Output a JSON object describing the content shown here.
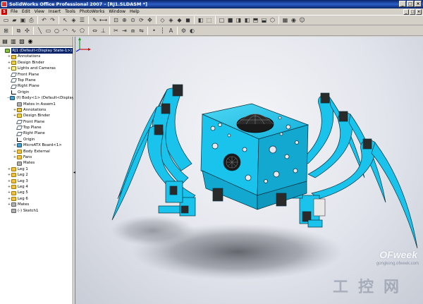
{
  "window": {
    "title": "SolidWorks Office Professional 2007 - [RJ1.SLDASM *]",
    "buttons": [
      "_",
      "□",
      "×"
    ]
  },
  "menu": {
    "items": [
      "File",
      "Edit",
      "View",
      "Insert",
      "Tools",
      "PhotoWorks",
      "Window",
      "Help"
    ],
    "buttons": [
      "_",
      "□",
      "×"
    ]
  },
  "toolbar1": {
    "icons": [
      "new-icon",
      "open-icon",
      "save-icon",
      "print-icon",
      "sep",
      "undo-icon",
      "redo-icon",
      "sep",
      "select-icon",
      "rebuild-icon",
      "options-icon",
      "sep",
      "sketch-icon",
      "smart-dimension-icon",
      "sep",
      "zoom-to-fit-icon",
      "zoom-area-icon",
      "zoom-in-icon",
      "rotate-icon",
      "pan-icon",
      "sep",
      "wireframe-icon",
      "hidden-lines-icon",
      "shaded-icon",
      "shaded-edges-icon",
      "sep",
      "section-view-icon",
      "view-orientation-icon",
      "sep",
      "front-view-icon",
      "back-view-icon",
      "left-view-icon",
      "right-view-icon",
      "top-view-icon",
      "bottom-view-icon",
      "iso-view-icon",
      "sep",
      "photoworks-icon",
      "render-icon",
      "smiley-icon"
    ]
  },
  "toolbar2": {
    "icons": [
      "insert-component-icon",
      "sep",
      "mate-icon",
      "move-component-icon",
      "sep",
      "line-icon",
      "rectangle-icon",
      "circle-icon",
      "arc-icon",
      "spline-icon",
      "polygon-icon",
      "sep",
      "dimension-icon",
      "relations-icon",
      "sep",
      "trim-icon",
      "extend-icon",
      "offset-icon",
      "mirror-icon",
      "sep",
      "point-icon",
      "centerline-icon",
      "text-icon",
      "sep",
      "tools-icon",
      "display-icon"
    ]
  },
  "panel": {
    "tabs": [
      "feature-manager-icon",
      "property-manager-icon",
      "configuration-manager-icon",
      "photoworks-tab-icon"
    ],
    "tree": [
      {
        "label": "RJ1 (Default<Display State-1>)",
        "level": 0,
        "icon": "ic-asm",
        "exp": "",
        "selected": true
      },
      {
        "label": "Annotations",
        "level": 1,
        "icon": "ic-a",
        "exp": "+"
      },
      {
        "label": "Design Binder",
        "level": 1,
        "icon": "ic-yellow",
        "exp": "+"
      },
      {
        "label": "Lights and Cameras",
        "level": 1,
        "icon": "ic-light",
        "exp": "+"
      },
      {
        "label": "Front Plane",
        "level": 1,
        "icon": "ic-plane",
        "exp": ""
      },
      {
        "label": "Top Plane",
        "level": 1,
        "icon": "ic-plane",
        "exp": ""
      },
      {
        "label": "Right Plane",
        "level": 1,
        "icon": "ic-plane",
        "exp": ""
      },
      {
        "label": "Origin",
        "level": 1,
        "icon": "ic-origin",
        "exp": ""
      },
      {
        "label": "(f) Body<1> (Default<Display Stat",
        "level": 1,
        "icon": "ic-part",
        "exp": "−"
      },
      {
        "label": "Mates in Assem1",
        "level": 2,
        "icon": "ic-gray",
        "exp": ""
      },
      {
        "label": "Annotations",
        "level": 2,
        "icon": "ic-a",
        "exp": "+"
      },
      {
        "label": "Design Binder",
        "level": 2,
        "icon": "ic-yellow",
        "exp": "+"
      },
      {
        "label": "Front Plane",
        "level": 2,
        "icon": "ic-plane",
        "exp": ""
      },
      {
        "label": "Top Plane",
        "level": 2,
        "icon": "ic-plane",
        "exp": ""
      },
      {
        "label": "Right Plane",
        "level": 2,
        "icon": "ic-plane",
        "exp": ""
      },
      {
        "label": "Origin",
        "level": 2,
        "icon": "ic-origin",
        "exp": ""
      },
      {
        "label": "MicroATX Board<1>",
        "level": 2,
        "icon": "ic-part",
        "exp": "+"
      },
      {
        "label": "Body External",
        "level": 2,
        "icon": "ic-folder",
        "exp": "+"
      },
      {
        "label": "Fans",
        "level": 2,
        "icon": "ic-folder",
        "exp": "+"
      },
      {
        "label": "Mates",
        "level": 2,
        "icon": "ic-gray",
        "exp": ""
      },
      {
        "label": "Leg 1",
        "level": 1,
        "icon": "ic-folder",
        "exp": "+"
      },
      {
        "label": "Leg 2",
        "level": 1,
        "icon": "ic-folder",
        "exp": "+"
      },
      {
        "label": "Leg 3",
        "level": 1,
        "icon": "ic-folder",
        "exp": "+"
      },
      {
        "label": "Leg 4",
        "level": 1,
        "icon": "ic-folder",
        "exp": "+"
      },
      {
        "label": "Leg 5",
        "level": 1,
        "icon": "ic-folder",
        "exp": "+"
      },
      {
        "label": "Leg 6",
        "level": 1,
        "icon": "ic-folder",
        "exp": "+"
      },
      {
        "label": "Mates",
        "level": 1,
        "icon": "ic-gray",
        "exp": "+"
      },
      {
        "label": "(-) Sketch1",
        "level": 1,
        "icon": "ic-gray",
        "exp": ""
      }
    ]
  },
  "viewport": {
    "model_color": "#19c3ec",
    "watermark_brand": "OFweek",
    "watermark_url": "gongkong.ofweek.com",
    "watermark_cn": "工控网"
  }
}
